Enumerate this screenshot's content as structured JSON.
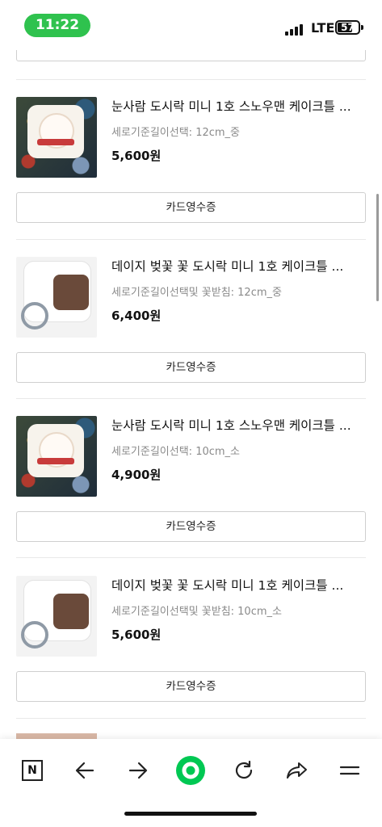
{
  "status": {
    "time": "11:22",
    "network": "LTE",
    "battery": "57"
  },
  "items": [
    {
      "title": "눈사람 도시락 미니 1호 스노우맨 케이크틀 ...",
      "option": "세로기준길이선택: 12cm_중",
      "price": "5,600원",
      "receipt": "카드영수증",
      "image": "snowman-cake-image"
    },
    {
      "title": "데이지 벚꽃 꽃 도시락 미니 1호 케이크틀 ...",
      "option": "세로기준길이선택및 꽃받침: 12cm_중",
      "price": "6,400원",
      "receipt": "카드영수증",
      "image": "daisy-cake-image"
    },
    {
      "title": "눈사람 도시락 미니 1호 스노우맨 케이크틀 ...",
      "option": "세로기준길이선택: 10cm_소",
      "price": "4,900원",
      "receipt": "카드영수증",
      "image": "snowman-cake-image"
    },
    {
      "title": "데이지 벚꽃 꽃 도시락 미니 1호 케이크틀 ...",
      "option": "세로기준길이선택및 꽃받침: 10cm_소",
      "price": "5,600원",
      "receipt": "카드영수증",
      "image": "daisy-cake-image"
    }
  ],
  "bottom_nav": [
    "naver-n-icon",
    "back-arrow-icon",
    "forward-arrow-icon",
    "green-circle-home-icon",
    "refresh-icon",
    "share-icon",
    "menu-icon"
  ]
}
